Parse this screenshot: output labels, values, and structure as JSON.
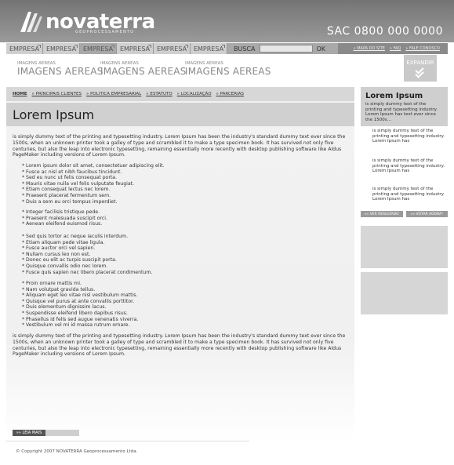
{
  "header": {
    "logo_text": "novaterra",
    "logo_sub": "GEOPROCESSAMENTO",
    "sac": "SAC 0800 000 0000"
  },
  "topnav": {
    "tabs": [
      "EMPRESA",
      "EMPRESA",
      "EMPRESA",
      "EMPRESA",
      "EMPRESA",
      "EMPRESA"
    ],
    "busca_label": "BUSCA",
    "busca_placeholder": "",
    "ok_label": "OK",
    "links": [
      "» MAPA DO SITE",
      "» FAQ",
      "» FALE CONOSCO"
    ]
  },
  "banner": {
    "items": [
      {
        "small": "IMAGENS AEREAS",
        "big": "IMAGENS AEREAS"
      },
      {
        "small": "IMAGENS AEREAS",
        "big": "IMAGENS AEREAS"
      },
      {
        "small": "IMAGENS AEREAS",
        "big": "IMAGENS AEREAS"
      }
    ],
    "expand_label": "EXPANDIR"
  },
  "breadcrumb": {
    "home": "HOME",
    "links": [
      "» PRINCIPAIS CLIENTES",
      "» POLITICA EMPRESARIAL",
      "» ESTATUTO",
      "» LOCALIZAÇÃO",
      "» PARCERIAS"
    ]
  },
  "main": {
    "title": "Lorem Ipsum",
    "paragraph1": "is simply dummy text of the printing and typesetting industry. Lorem Ipsum has been the industry's standard dummy text ever since the 1500s, when an unknown printer took a galley of type and scrambled it to make a type specimen book. It has survived not only five centuries, but also the leap into electronic typesetting, remaining essentially more recently with desktop publishing software like Aldus PageMaker including versions of Lorem Ipsum.",
    "list1": [
      "* Lorem ipsum dolor sit amet, consectetuer adipiscing elit.",
      "* Fusce ac nisl et nibh faucibus tincidunt.",
      "* Sed eu nunc ut felis consequat porta.",
      "* Mauris vitae nulla vel felis vulputate feugiat.",
      "* Etiam consequat lectus nec lorem.",
      "* Praesent placerat fermentum sem.",
      "* Duis a sem eu orci tempus imperdiet."
    ],
    "list2": [
      "* Integer facilisis tristique pede.",
      "* Praesent malesuada suscipit orci.",
      "* Aenean eleifend euismod risus."
    ],
    "list3": [
      "* Sed quis tortor ac neque iaculis interdum.",
      "* Etiam aliquam pede vitae ligula.",
      "* Fusce auctor orci vel sapien.",
      "* Nullam cursus leo non est.",
      "* Donec eu elit ac turpis suscipit porta.",
      "* Quisque convallis odio nec lorem.",
      "* Fusce quis sapien nec libero placerat condimentum."
    ],
    "list4": [
      "* Proin ornare mattis mi.",
      "* Nam volutpat gravida tellus.",
      "* Aliquam eget leo vitae nisl vestibulum mattis.",
      "* Quisque vel purus at ante convallis porttitor.",
      "* Duis elementum dignissim lacus.",
      "* Suspendisse eleifend libero dapibus risus.",
      "* Phasellus id felis sed augue venenatis viverra.",
      "* Vestibulum vel mi id massa rutrum ornare."
    ],
    "paragraph2": "is simply dummy text of the printing and typesetting industry. Lorem Ipsum has been the industry's standard dummy text ever since the 1500s, when an unknown printer took a galley of type and scrambled it to make a type specimen book. It has survived not only five centuries, but also the leap into electronic typesetting, remaining essentially more recently with desktop publishing software like Aldus PageMaker including versions of Lorem Ipsum.",
    "leia_mais": "»» LEIA MAIS"
  },
  "footer": {
    "copyright": "© Copyright 2007 NOVATERRA Geoprocessamento Ltda."
  },
  "sidebar": {
    "title": "Lorem Ipsum",
    "desc": "is simply dummy text of the printing and typesetting industry. Lorem Ipsum has text ever since the 1500s...",
    "items": [
      "is simply dummy text of the printing and typesetting industry. Lorem Ipsum has",
      "is simply dummy text of the printing and typesetting industry. Lorem Ipsum has",
      "is simply dummy text of the printing and typesetting industry. Lorem Ipsum has"
    ],
    "btn_result": "»» VER RESULTADO",
    "btn_vote": "»» VOTAR AGORA!"
  }
}
